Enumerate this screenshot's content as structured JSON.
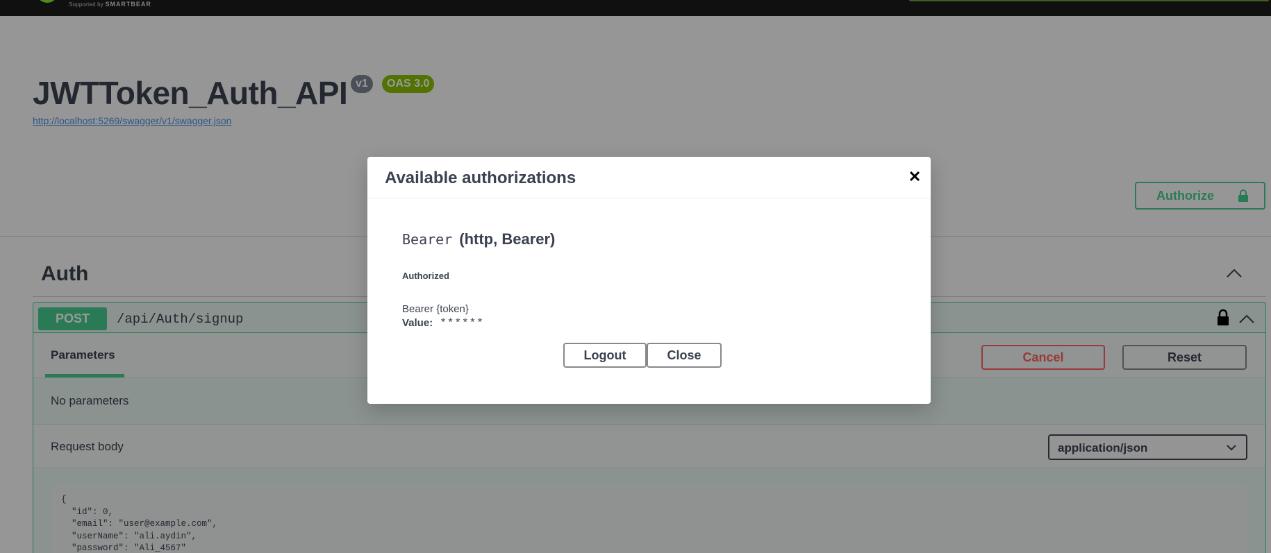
{
  "topbar": {
    "supported_by": "Supported by",
    "brand": "SMARTBEAR"
  },
  "info": {
    "title": "JWTToken_Auth_API",
    "version_badge": "v1",
    "oas_badge": "OAS 3.0",
    "spec_url": "http://localhost:5269/swagger/v1/swagger.json"
  },
  "authorize_button": {
    "label": "Authorize",
    "icon": "lock-icon"
  },
  "tag": {
    "name": "Auth"
  },
  "operation": {
    "method": "POST",
    "path": "/api/Auth/signup",
    "parameters_tab": "Parameters",
    "cancel_label": "Cancel",
    "reset_label": "Reset",
    "no_parameters": "No parameters",
    "request_body_label": "Request body",
    "content_type": "application/json",
    "example_body": "{\n  \"id\": 0,\n  \"email\": \"user@example.com\",\n  \"userName\": \"ali.aydin\",\n  \"password\": \"Ali_4567\""
  },
  "modal": {
    "title": "Available authorizations",
    "close_icon": "close-icon",
    "scheme_name": "Bearer",
    "scheme_type": "(http, Bearer)",
    "status": "Authorized",
    "format": "Bearer {token}",
    "value_label": "Value:",
    "value_mask": "******",
    "logout_label": "Logout",
    "close_label": "Close"
  },
  "colors": {
    "accent_green": "#49cc90",
    "danger_red": "#ff6060",
    "text_dark": "#3b4151",
    "link_blue": "#4990e2",
    "oas_badge": "#89bf04",
    "version_badge": "#7d8492"
  }
}
